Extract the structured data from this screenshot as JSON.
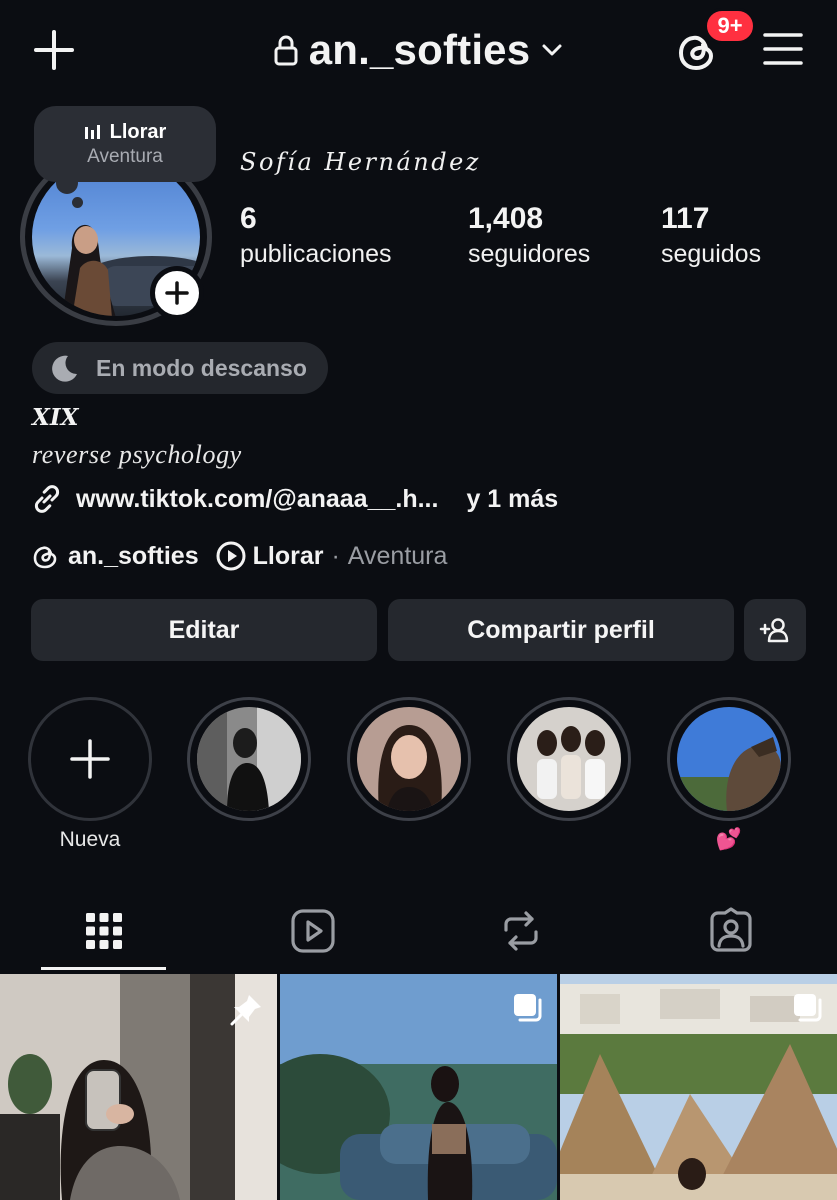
{
  "header": {
    "username": "an._softies",
    "notification_badge": "9+",
    "icons": {
      "create": "plus-icon",
      "lock": "lock-icon",
      "switch": "chevron-down-icon",
      "threads": "threads-icon",
      "menu": "hamburger-menu-icon"
    },
    "badge_color": "#ff3040"
  },
  "note": {
    "title": "Llorar",
    "subtitle": "Aventura",
    "icon": "audio-bars-icon"
  },
  "profile": {
    "full_name": "Sofía Hernández",
    "stats": [
      {
        "value": "6",
        "label": "publicaciones"
      },
      {
        "value": "1,408",
        "label": "seguidores"
      },
      {
        "value": "117",
        "label": "seguidos"
      }
    ],
    "rest_mode": "En modo descanso",
    "bio_line1": "XIX",
    "bio_line2": "reverse psychology",
    "link_text": "www.tiktok.com/@anaaa__.h...",
    "link_more": "y 1 más",
    "threads_handle": "an._softies",
    "music_title": "Llorar",
    "music_separator": "·",
    "music_artist": "Aventura"
  },
  "buttons": {
    "edit": "Editar",
    "share": "Compartir perfil",
    "discover_people": "add-person-icon"
  },
  "highlights": [
    {
      "label": "Nueva",
      "icon": "plus-icon"
    },
    {
      "label": ""
    },
    {
      "label": ""
    },
    {
      "label": ""
    },
    {
      "label": "💕"
    }
  ],
  "tabs": [
    {
      "name": "posts",
      "icon": "grid-icon",
      "active": true
    },
    {
      "name": "reels",
      "icon": "reels-icon",
      "active": false
    },
    {
      "name": "reposts",
      "icon": "repost-icon",
      "active": false
    },
    {
      "name": "tagged",
      "icon": "tagged-person-icon",
      "active": false
    }
  ],
  "posts": [
    {
      "overlay_icon": "pin-icon"
    },
    {
      "overlay_icon": "carousel-icon"
    },
    {
      "overlay_icon": "carousel-icon"
    }
  ]
}
